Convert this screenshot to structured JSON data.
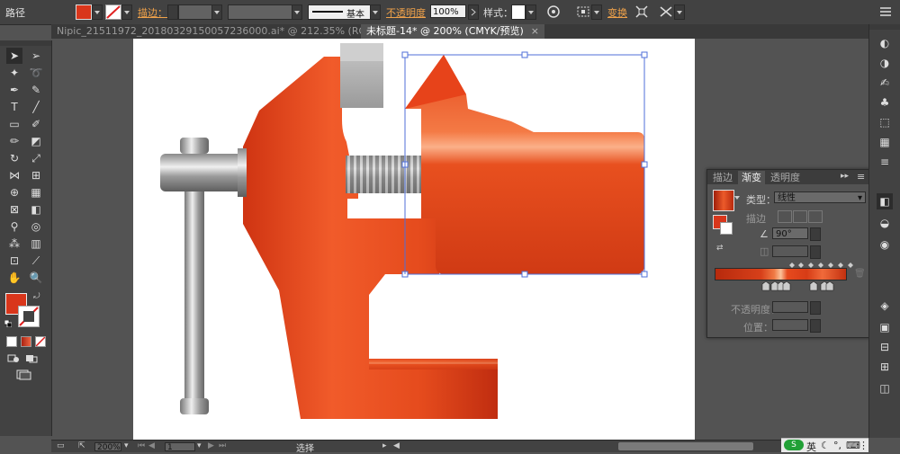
{
  "control_bar": {
    "selection_label": "路径",
    "fill_color": "#d9361b",
    "stroke_label": "描边：",
    "stroke_style_label": "基本",
    "opacity_label": "不透明度",
    "opacity_value": "100%",
    "style_label": "样式：",
    "transform_label": "变换"
  },
  "tabs": [
    {
      "label": "Nipic_21511972_20180329150057236000.ai* @ 212.35% (RGB/预览)",
      "close": "×"
    },
    {
      "label": "未标题-14* @ 200% (CMYK/预览)",
      "close": "×"
    }
  ],
  "tools_icons": [
    "selection-tool",
    "direct-selection-tool",
    "magic-wand-tool",
    "lasso-tool",
    "pen-tool",
    "curvature-tool",
    "type-tool",
    "line-tool",
    "rectangle-tool",
    "paintbrush-tool",
    "pencil-tool",
    "eraser-tool",
    "rotate-tool",
    "scale-tool",
    "width-tool",
    "free-transform-tool",
    "shape-builder-tool",
    "perspective-grid-tool",
    "mesh-tool",
    "gradient-tool",
    "eyedropper-tool",
    "blend-tool",
    "symbol-sprayer-tool",
    "column-graph-tool",
    "artboard-tool",
    "slice-tool",
    "hand-tool",
    "zoom-tool"
  ],
  "gradient_panel": {
    "tabs": [
      "描边",
      "渐变",
      "透明度"
    ],
    "active_tab": "渐变",
    "type_label": "类型：",
    "type_value": "线性",
    "stroke_label": "描边",
    "angle_value": "90°",
    "opacity_label": "不透明度：",
    "position_label": "位置："
  },
  "status_bar": {
    "zoom": "200%",
    "page": "1",
    "tool_label": "选择"
  },
  "ime": {
    "lang": "英"
  },
  "colors": {
    "vise_orange": "#e8461c",
    "vise_dark": "#c93212",
    "steel": "#b9b9b9"
  }
}
